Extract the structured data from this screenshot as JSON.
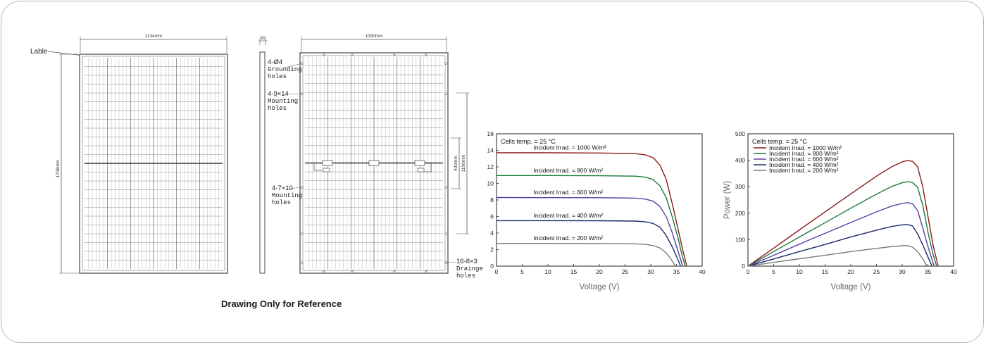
{
  "caption": "Drawing Only for Reference",
  "drawing": {
    "front": {
      "label_callout": "Lable",
      "width_dim": "1134mm",
      "height_dim": "1708mm"
    },
    "side": {
      "thickness_dim": "30"
    },
    "back": {
      "width_dim": "1090mm",
      "mount_span_dim": "1100mm",
      "ground_span_dim": "400mm",
      "callouts": [
        {
          "id": "grounding",
          "lines": [
            "4-Ø4",
            "Grounding",
            "holes"
          ]
        },
        {
          "id": "mounting",
          "lines": [
            "4-9×14",
            "Mounting",
            "holes"
          ]
        },
        {
          "id": "mounting2",
          "lines": [
            "4-7×10",
            "Mounting",
            "holes"
          ]
        },
        {
          "id": "drainage",
          "lines": [
            "16-8×3",
            "Drainge",
            "holes"
          ]
        }
      ]
    }
  },
  "colors": {
    "s1000": "#8b1a1a",
    "s800": "#1a7a3a",
    "s600": "#5a3fa8",
    "s400": "#1a2a6a",
    "s200": "#7a7a7a",
    "line": "#555555"
  },
  "chart_data": [
    {
      "type": "line",
      "title": "",
      "xlabel": "Voltage (V)",
      "ylabel": "",
      "xlim": [
        0,
        40
      ],
      "ylim": [
        0,
        16
      ],
      "xticks": [
        0,
        5,
        10,
        15,
        20,
        25,
        30,
        35,
        40
      ],
      "yticks": [
        0,
        2,
        4,
        6,
        8,
        10,
        12,
        14,
        16
      ],
      "annotation": "Cells temp. = 25 °C",
      "legend": "inline labels",
      "series": [
        {
          "name": "Incident Irrad. = 1000 W/m²",
          "color": "#8b1a1a",
          "points": [
            [
              0,
              13.7
            ],
            [
              10,
              13.7
            ],
            [
              20,
              13.68
            ],
            [
              27,
              13.6
            ],
            [
              29,
              13.45
            ],
            [
              30.5,
              13.1
            ],
            [
              31.8,
              12.2
            ],
            [
              33,
              10.5
            ],
            [
              34.2,
              7.5
            ],
            [
              35.3,
              4.5
            ],
            [
              36.2,
              2.0
            ],
            [
              37,
              0
            ]
          ]
        },
        {
          "name": "Incident Irrad. = 800 W/m²",
          "color": "#1a7a3a",
          "points": [
            [
              0,
              10.95
            ],
            [
              10,
              10.95
            ],
            [
              20,
              10.93
            ],
            [
              27,
              10.88
            ],
            [
              29,
              10.75
            ],
            [
              30.5,
              10.45
            ],
            [
              31.8,
              9.7
            ],
            [
              33,
              8.3
            ],
            [
              34.2,
              5.9
            ],
            [
              35.3,
              3.4
            ],
            [
              36.1,
              1.3
            ],
            [
              36.7,
              0
            ]
          ]
        },
        {
          "name": "Incident Irrad. = 600 W/m²",
          "color": "#5a3fa8",
          "points": [
            [
              0,
              8.3
            ],
            [
              10,
              8.28
            ],
            [
              20,
              8.27
            ],
            [
              27,
              8.22
            ],
            [
              29,
              8.1
            ],
            [
              30.5,
              7.85
            ],
            [
              31.8,
              7.2
            ],
            [
              33,
              6.0
            ],
            [
              34.2,
              4.0
            ],
            [
              35.2,
              2.0
            ],
            [
              36.2,
              0
            ]
          ]
        },
        {
          "name": "Incident Irrad. = 400 W/m²",
          "color": "#1a2a6a",
          "points": [
            [
              0,
              5.5
            ],
            [
              10,
              5.5
            ],
            [
              20,
              5.49
            ],
            [
              27,
              5.45
            ],
            [
              29,
              5.35
            ],
            [
              30.5,
              5.15
            ],
            [
              31.8,
              4.7
            ],
            [
              33,
              3.7
            ],
            [
              34.2,
              2.3
            ],
            [
              35.2,
              0.9
            ],
            [
              35.8,
              0
            ]
          ]
        },
        {
          "name": "Incident Irrad. = 200 W/m²",
          "color": "#7a7a7a",
          "points": [
            [
              0,
              2.75
            ],
            [
              10,
              2.75
            ],
            [
              20,
              2.74
            ],
            [
              27,
              2.7
            ],
            [
              29,
              2.63
            ],
            [
              30.5,
              2.48
            ],
            [
              31.8,
              2.2
            ],
            [
              33,
              1.6
            ],
            [
              34,
              0.8
            ],
            [
              34.8,
              0
            ]
          ]
        }
      ]
    },
    {
      "type": "line",
      "title": "",
      "xlabel": "Voltage (V)",
      "ylabel": "Power (W)",
      "xlim": [
        0,
        40
      ],
      "ylim": [
        0,
        500
      ],
      "xticks": [
        0,
        5,
        10,
        15,
        20,
        25,
        30,
        35,
        40
      ],
      "yticks": [
        0,
        100,
        200,
        300,
        400,
        500
      ],
      "annotation": "Cells temp. = 25 °C",
      "legend": "top-left",
      "series": [
        {
          "name": "Incident Irrad. = 1000 W/m²",
          "color": "#8b1a1a",
          "points": [
            [
              0,
              0
            ],
            [
              5,
              68
            ],
            [
              10,
              137
            ],
            [
              15,
              205
            ],
            [
              20,
              273
            ],
            [
              25,
              340
            ],
            [
              28,
              376
            ],
            [
              30,
              394
            ],
            [
              31,
              399
            ],
            [
              32,
              396
            ],
            [
              33,
              375
            ],
            [
              34,
              300
            ],
            [
              35,
              190
            ],
            [
              36,
              80
            ],
            [
              37,
              0
            ]
          ]
        },
        {
          "name": "Incident Irrad. = 800 W/m²",
          "color": "#1a7a3a",
          "points": [
            [
              0,
              0
            ],
            [
              5,
              55
            ],
            [
              10,
              110
            ],
            [
              15,
              164
            ],
            [
              20,
              219
            ],
            [
              25,
              272
            ],
            [
              28,
              301
            ],
            [
              30,
              315
            ],
            [
              31,
              319
            ],
            [
              32,
              316
            ],
            [
              33,
              298
            ],
            [
              34,
              230
            ],
            [
              35,
              130
            ],
            [
              36,
              45
            ],
            [
              36.7,
              0
            ]
          ]
        },
        {
          "name": "Incident Irrad. = 600 W/m²",
          "color": "#5a3fa8",
          "points": [
            [
              0,
              0
            ],
            [
              5,
              41
            ],
            [
              10,
              83
            ],
            [
              15,
              124
            ],
            [
              20,
              165
            ],
            [
              25,
              205
            ],
            [
              28,
              227
            ],
            [
              30,
              237
            ],
            [
              31,
              240
            ],
            [
              32,
              236
            ],
            [
              33,
              210
            ],
            [
              34,
              145
            ],
            [
              35,
              75
            ],
            [
              36.2,
              0
            ]
          ]
        },
        {
          "name": "Incident Irrad. = 400 W/m²",
          "color": "#1a2a6a",
          "points": [
            [
              0,
              0
            ],
            [
              5,
              27
            ],
            [
              10,
              55
            ],
            [
              15,
              82
            ],
            [
              20,
              110
            ],
            [
              25,
              136
            ],
            [
              28,
              150
            ],
            [
              30,
              156
            ],
            [
              31,
              157
            ],
            [
              32,
              152
            ],
            [
              33,
              122
            ],
            [
              34,
              80
            ],
            [
              35,
              35
            ],
            [
              35.8,
              0
            ]
          ]
        },
        {
          "name": "Incident Irrad. = 200 W/m²",
          "color": "#7a7a7a",
          "points": [
            [
              0,
              0
            ],
            [
              5,
              14
            ],
            [
              10,
              28
            ],
            [
              15,
              41
            ],
            [
              20,
              55
            ],
            [
              25,
              67
            ],
            [
              28,
              74
            ],
            [
              30,
              77
            ],
            [
              31,
              77
            ],
            [
              32,
              72
            ],
            [
              33,
              55
            ],
            [
              34,
              28
            ],
            [
              34.8,
              0
            ]
          ]
        }
      ]
    }
  ]
}
